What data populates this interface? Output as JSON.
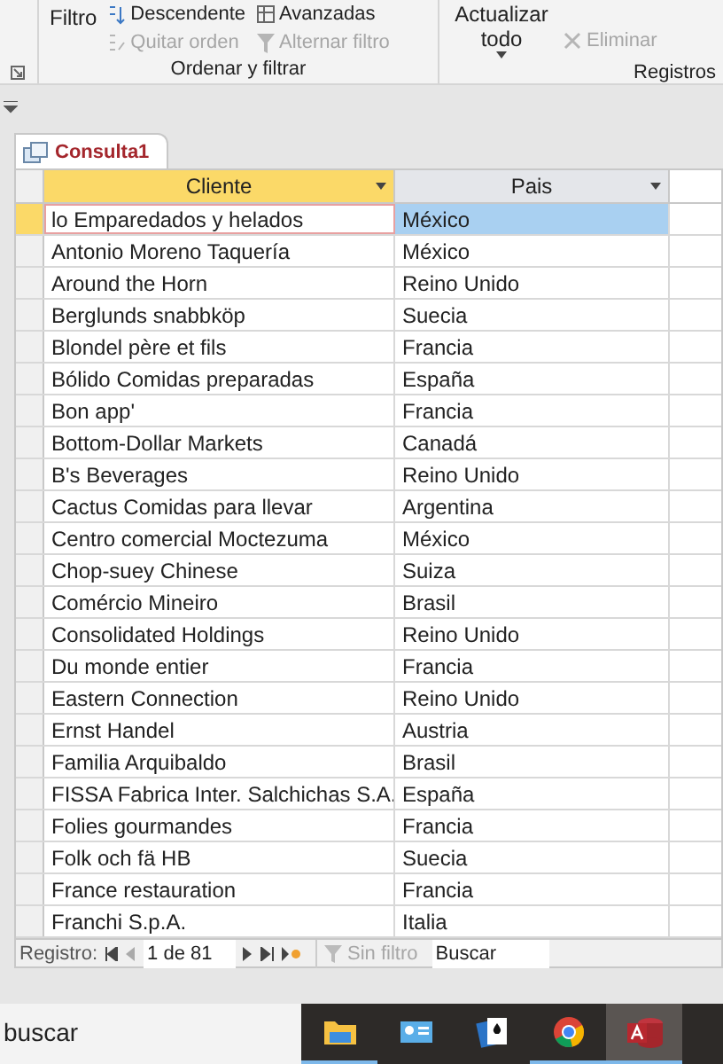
{
  "ribbon": {
    "groups": [
      {
        "title": "Ordenar y filtrar",
        "big": {
          "label": "Filtro"
        },
        "items": [
          {
            "label": "Descendente",
            "disabled": false
          },
          {
            "label": "Quitar orden",
            "disabled": true
          },
          {
            "label": "Avanzadas",
            "disabled": false
          },
          {
            "label": "Alternar filtro",
            "disabled": true
          }
        ]
      },
      {
        "title": "Registros",
        "big": {
          "label": "Actualizar todo"
        },
        "items": [
          {
            "label": "Eliminar",
            "disabled": true
          }
        ]
      }
    ]
  },
  "document_tab": {
    "title": "Consulta1"
  },
  "table": {
    "columns": [
      "Cliente",
      "Pais"
    ],
    "rows": [
      {
        "cells": [
          "lo Emparedados y helados",
          "México"
        ],
        "selected": true
      },
      {
        "cells": [
          "Antonio Moreno Taquería",
          "México"
        ],
        "selected": false
      },
      {
        "cells": [
          "Around the Horn",
          "Reino Unido"
        ],
        "selected": false
      },
      {
        "cells": [
          "Berglunds snabbköp",
          "Suecia"
        ],
        "selected": false
      },
      {
        "cells": [
          "Blondel père et fils",
          "Francia"
        ],
        "selected": false
      },
      {
        "cells": [
          "Bólido Comidas preparadas",
          "España"
        ],
        "selected": false
      },
      {
        "cells": [
          "Bon app'",
          "Francia"
        ],
        "selected": false
      },
      {
        "cells": [
          "Bottom-Dollar Markets",
          "Canadá"
        ],
        "selected": false
      },
      {
        "cells": [
          "B's Beverages",
          "Reino Unido"
        ],
        "selected": false
      },
      {
        "cells": [
          "Cactus Comidas para llevar",
          "Argentina"
        ],
        "selected": false
      },
      {
        "cells": [
          "Centro comercial Moctezuma",
          "México"
        ],
        "selected": false
      },
      {
        "cells": [
          "Chop-suey Chinese",
          "Suiza"
        ],
        "selected": false
      },
      {
        "cells": [
          "Comércio Mineiro",
          "Brasil"
        ],
        "selected": false
      },
      {
        "cells": [
          "Consolidated Holdings",
          "Reino Unido"
        ],
        "selected": false
      },
      {
        "cells": [
          "Du monde entier",
          "Francia"
        ],
        "selected": false
      },
      {
        "cells": [
          "Eastern Connection",
          "Reino Unido"
        ],
        "selected": false
      },
      {
        "cells": [
          "Ernst Handel",
          "Austria"
        ],
        "selected": false
      },
      {
        "cells": [
          "Familia Arquibaldo",
          "Brasil"
        ],
        "selected": false
      },
      {
        "cells": [
          "FISSA Fabrica Inter. Salchichas S.A.",
          "España"
        ],
        "selected": false
      },
      {
        "cells": [
          "Folies gourmandes",
          "Francia"
        ],
        "selected": false
      },
      {
        "cells": [
          "Folk och fä HB",
          "Suecia"
        ],
        "selected": false
      },
      {
        "cells": [
          "France restauration",
          "Francia"
        ],
        "selected": false
      },
      {
        "cells": [
          "Franchi S.p.A.",
          "Italia"
        ],
        "selected": false
      }
    ]
  },
  "record_nav": {
    "label": "Registro:",
    "position": "1 de 81",
    "filter": {
      "label": "Sin filtro",
      "disabled": true
    },
    "search": {
      "placeholder": "Buscar"
    }
  },
  "taskbar": {
    "search": {
      "placeholder": "buscar"
    },
    "apps": [
      {
        "kind": "folder",
        "running": true,
        "selected": false
      },
      {
        "kind": "card",
        "running": false,
        "selected": false
      },
      {
        "kind": "cards",
        "running": false,
        "selected": false
      },
      {
        "kind": "browser",
        "running": true,
        "selected": false
      },
      {
        "kind": "database",
        "running": true,
        "selected": true
      }
    ]
  }
}
